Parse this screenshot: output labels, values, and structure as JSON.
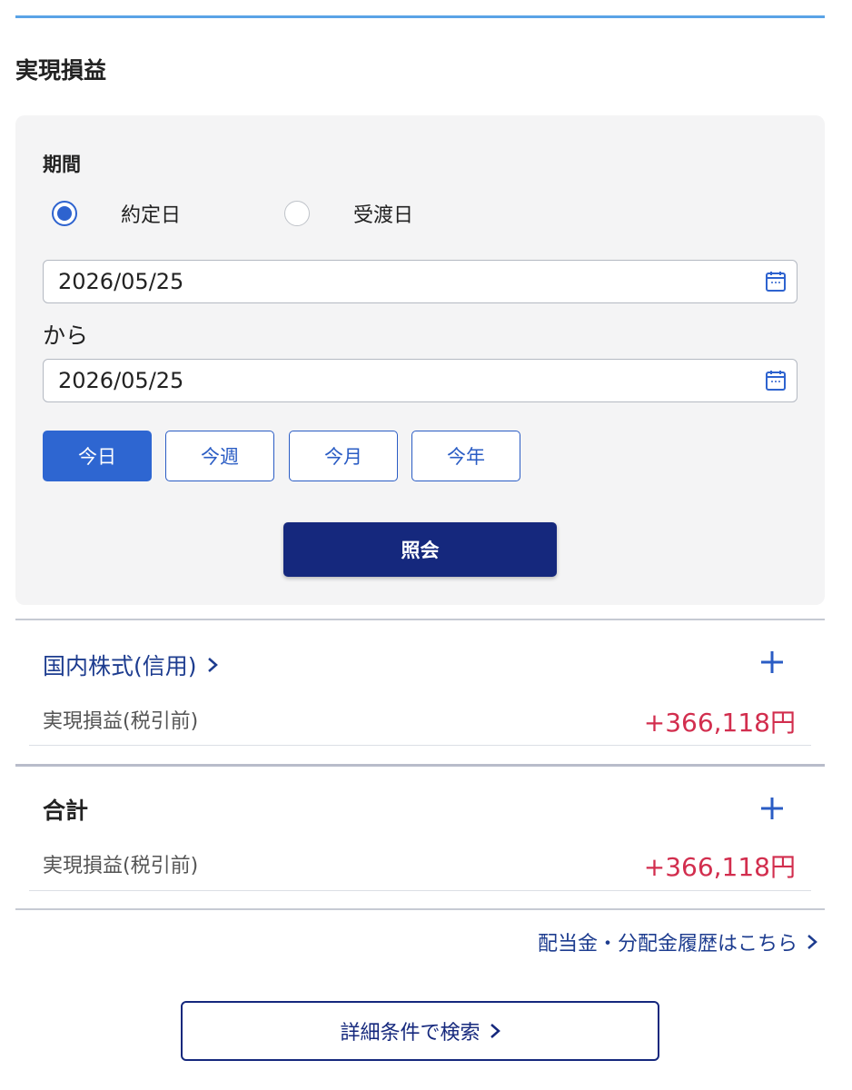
{
  "page": {
    "title": "実現損益"
  },
  "filter": {
    "period_label": "期間",
    "radio_options": [
      {
        "label": "約定日",
        "selected": true
      },
      {
        "label": "受渡日",
        "selected": false
      }
    ],
    "date_from": "2026/05/25",
    "separator": "から",
    "date_to": "2026/05/25",
    "quick_buttons": [
      {
        "label": "今日",
        "active": true
      },
      {
        "label": "今週",
        "active": false
      },
      {
        "label": "今月",
        "active": false
      },
      {
        "label": "今年",
        "active": false
      }
    ],
    "submit_label": "照会"
  },
  "sections": [
    {
      "title": "国内株式(信用)",
      "row_label": "実現損益(税引前)",
      "row_value": "+366,118円"
    }
  ],
  "total": {
    "title": "合計",
    "row_label": "実現損益(税引前)",
    "row_value": "+366,118円"
  },
  "links": {
    "dividend": "配当金・分配金履歴はこちら",
    "detail_search": "詳細条件で検索"
  },
  "colors": {
    "accent": "#2e66d1",
    "primary_dark": "#15287d",
    "link": "#1d3c8f",
    "positive_value": "#d22e4e",
    "top_rule": "#5aa3e6"
  },
  "icons": {
    "date_picker": "calendar-icon",
    "expand": "plus-icon",
    "navigate": "chevron-right-icon"
  }
}
